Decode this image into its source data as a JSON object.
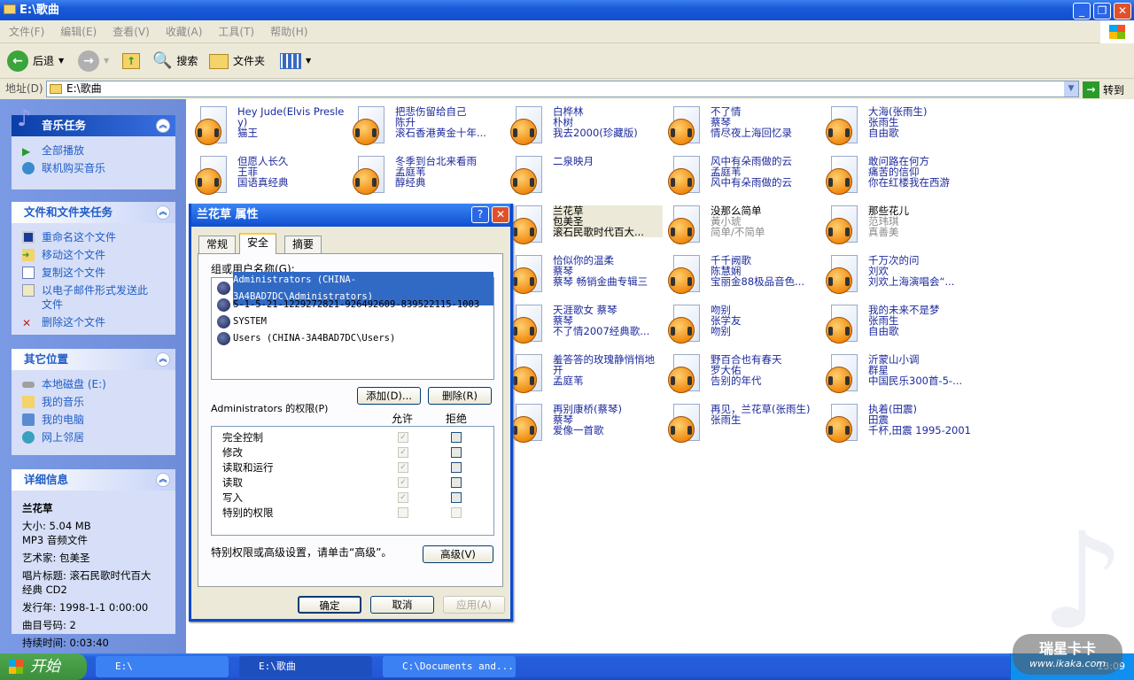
{
  "window": {
    "title": "E:\\歌曲"
  },
  "menu": [
    "文件(F)",
    "编辑(E)",
    "查看(V)",
    "收藏(A)",
    "工具(T)",
    "帮助(H)"
  ],
  "toolbar": {
    "back": "后退",
    "search": "搜索",
    "folders": "文件夹"
  },
  "address": {
    "label": "地址(D)",
    "value": "E:\\歌曲",
    "go": "转到"
  },
  "sidebar": {
    "music_tasks": {
      "title": "音乐任务",
      "items": [
        "全部播放",
        "联机购买音乐"
      ]
    },
    "file_tasks": {
      "title": "文件和文件夹任务",
      "items": [
        "重命名这个文件",
        "移动这个文件",
        "复制这个文件",
        "以电子邮件形式发送此文件",
        "删除这个文件"
      ]
    },
    "other_places": {
      "title": "其它位置",
      "items": [
        "本地磁盘 (E:)",
        "我的音乐",
        "我的电脑",
        "网上邻居"
      ]
    },
    "details": {
      "title": "详细信息",
      "name": "兰花草",
      "size": "大小: 5.04 MB",
      "type": "MP3 音频文件",
      "artist": "艺术家: 包美圣",
      "album": "唱片标题: 滚石民歌时代百大经典 CD2",
      "year": "发行年: 1998-1-1 0:00:00",
      "track": "曲目号码: 2",
      "duration": "持续时间: 0:03:40"
    }
  },
  "files": [
    {
      "col": 0,
      "row": 0,
      "lines": [
        "Hey Jude(Elvis Presley)",
        "猫王"
      ]
    },
    {
      "col": 0,
      "row": 1,
      "lines": [
        "但愿人长久",
        "王菲",
        "国语真经典"
      ]
    },
    {
      "col": 1,
      "row": 0,
      "lines": [
        "把悲伤留给自己",
        "陈升",
        "滚石香港黄金十年..."
      ]
    },
    {
      "col": 1,
      "row": 1,
      "lines": [
        "冬季到台北来看雨",
        "孟庭苇",
        "醇经典"
      ]
    },
    {
      "col": 2,
      "row": 0,
      "lines": [
        "白桦林",
        "朴树",
        "我去2000(珍藏版)"
      ]
    },
    {
      "col": 2,
      "row": 1,
      "lines": [
        "二泉映月"
      ]
    },
    {
      "col": 2,
      "row": 2,
      "lines": [
        "兰花草",
        "包美圣",
        "滚石民歌时代百大..."
      ],
      "selected": true
    },
    {
      "col": 2,
      "row": 3,
      "lines": [
        "恰似你的温柔",
        "蔡琴",
        "蔡琴 畅销金曲专辑三"
      ]
    },
    {
      "col": 2,
      "row": 4,
      "lines": [
        "天涯歌女 蔡琴",
        "蔡琴",
        "不了情2007经典歌..."
      ]
    },
    {
      "col": 2,
      "row": 5,
      "lines": [
        "羞答答的玫瑰静悄悄地开",
        "孟庭苇"
      ]
    },
    {
      "col": 2,
      "row": 6,
      "lines": [
        "再别康桥(蔡琴)",
        "蔡琴",
        "爱像一首歌"
      ]
    },
    {
      "col": 3,
      "row": 0,
      "lines": [
        "不了情",
        "蔡琴",
        "情尽夜上海回忆录"
      ]
    },
    {
      "col": 3,
      "row": 1,
      "lines": [
        "风中有朵雨做的云",
        "孟庭苇",
        "风中有朵雨做的云"
      ]
    },
    {
      "col": 3,
      "row": 2,
      "lines": [
        "没那么简单",
        "黃小琥",
        "简单/不简单"
      ],
      "grey": true
    },
    {
      "col": 3,
      "row": 3,
      "lines": [
        "千千阙歌",
        "陈慧娴",
        "宝丽金88极品音色..."
      ]
    },
    {
      "col": 3,
      "row": 4,
      "lines": [
        "吻别",
        "张学友",
        "吻别"
      ]
    },
    {
      "col": 3,
      "row": 5,
      "lines": [
        "野百合也有春天",
        "罗大佑",
        "告别的年代"
      ]
    },
    {
      "col": 3,
      "row": 6,
      "lines": [
        "再见，兰花草(张雨生)",
        "张雨生"
      ]
    },
    {
      "col": 4,
      "row": 0,
      "lines": [
        "大海(张雨生)",
        "张雨生",
        "自由歌"
      ]
    },
    {
      "col": 4,
      "row": 1,
      "lines": [
        "敢问路在何方",
        "痛苦的信仰",
        "你在红楼我在西游"
      ]
    },
    {
      "col": 4,
      "row": 2,
      "lines": [
        "那些花儿",
        "范玮琪",
        "真善美"
      ],
      "grey": true
    },
    {
      "col": 4,
      "row": 3,
      "lines": [
        "千万次的问",
        "刘欢",
        "刘欢上海演唱会“..."
      ]
    },
    {
      "col": 4,
      "row": 4,
      "lines": [
        "我的未来不是梦",
        "张雨生",
        "自由歌"
      ]
    },
    {
      "col": 4,
      "row": 5,
      "lines": [
        "沂蒙山小调",
        "群星",
        "中国民乐300首-5-..."
      ]
    },
    {
      "col": 4,
      "row": 6,
      "lines": [
        "执着(田震)",
        "田震",
        "千杯,田震 1995-2001"
      ]
    }
  ],
  "dialog": {
    "title": "兰花草 属性",
    "tabs": [
      "常规",
      "安全",
      "摘要"
    ],
    "group_label": "组或用户名称(G):",
    "users": [
      "Administrators (CHINA-3A4BAD7DC\\Administrators)",
      "S-1-5-21-1229272821-926492609-839522115-1003",
      "SYSTEM",
      "Users (CHINA-3A4BAD7DC\\Users)"
    ],
    "add": "添加(D)...",
    "remove": "删除(R)",
    "perm_label": "Administrators 的权限(P)",
    "allow": "允许",
    "deny": "拒绝",
    "perms": [
      {
        "name": "完全控制",
        "allow": true,
        "deny": false
      },
      {
        "name": "修改",
        "allow": true,
        "deny": false
      },
      {
        "name": "读取和运行",
        "allow": true,
        "deny": false
      },
      {
        "name": "读取",
        "allow": true,
        "deny": false
      },
      {
        "name": "写入",
        "allow": true,
        "deny": false
      },
      {
        "name": "特别的权限",
        "allow": false,
        "deny": false
      }
    ],
    "advanced_hint": "特别权限或高级设置，请单击“高级”。",
    "advanced": "高级(V)",
    "ok": "确定",
    "cancel": "取消",
    "apply": "应用(A)"
  },
  "taskbar": {
    "start": "开始",
    "tasks": [
      "E:\\",
      "E:\\歌曲",
      "C:\\Documents and..."
    ],
    "clock": "13:09"
  },
  "watermark": {
    "name": "瑞星卡卡",
    "url": "www.ikaka.com"
  }
}
